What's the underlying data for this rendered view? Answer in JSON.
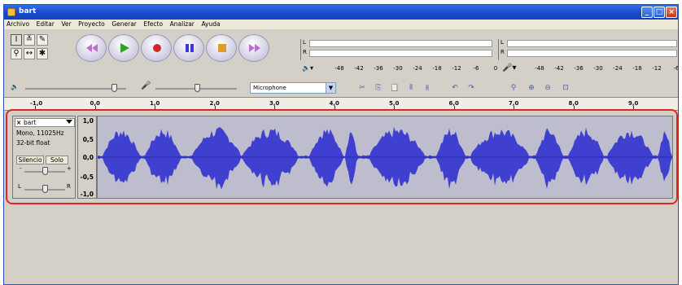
{
  "window": {
    "title": "bart"
  },
  "menu": [
    "Archivo",
    "Editar",
    "Ver",
    "Proyecto",
    "Generar",
    "Efecto",
    "Analizar",
    "Ayuda"
  ],
  "meters": {
    "play_l": "L",
    "play_r": "R",
    "rec_l": "L",
    "rec_r": "R",
    "scale_play": [
      "-48",
      "-42",
      "-36",
      "-30",
      "-24",
      "-18",
      "-12",
      "-6",
      "0"
    ],
    "scale_rec": [
      "-48",
      "-42",
      "-36",
      "-30",
      "-24",
      "-18",
      "-12",
      "-6"
    ]
  },
  "mixer": {
    "input_source": "Microphone"
  },
  "ruler": {
    "ticks": [
      "-1,0",
      "0,0",
      "1,0",
      "2,0",
      "3,0",
      "4,0",
      "5,0",
      "6,0",
      "7,0",
      "8,0",
      "9,0"
    ]
  },
  "track": {
    "name": "bart",
    "info_line1": "Mono, 11025Hz",
    "info_line2": "32-bit float",
    "mute_label": "Silencio",
    "solo_label": "Solo",
    "pan_left": "L",
    "pan_right": "R",
    "gain_minus": "-",
    "gain_plus": "+",
    "vscale": [
      "1,0",
      "0,5",
      "0,0",
      "-0,5",
      "-1,0"
    ]
  },
  "colors": {
    "title_bar": "#1748c9",
    "waveform": "#3f3fd0",
    "highlight_frame": "#e22424"
  }
}
